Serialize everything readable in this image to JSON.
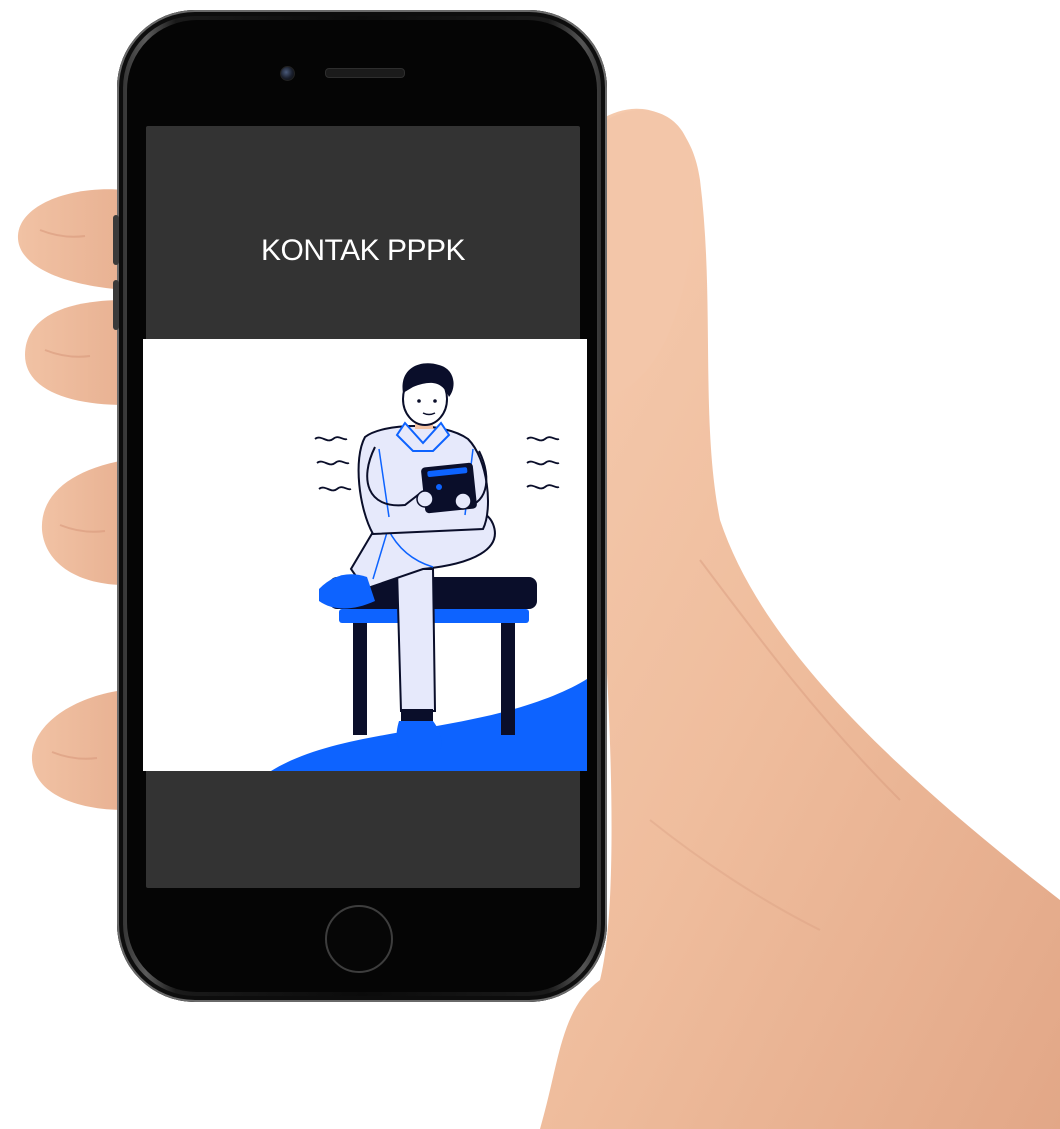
{
  "screen": {
    "title": "KONTAK PPPK"
  },
  "icons": {
    "front_camera": "camera-lens-icon",
    "earpiece": "speaker-grille-icon",
    "home": "home-button-icon"
  },
  "colors": {
    "screen_background": "#333333",
    "illustration_background": "#ffffff",
    "accent_blue": "#0d63ff",
    "light_lavender": "#e6e9fb",
    "navy": "#0a0e2a",
    "skin": "#f3c3a4"
  }
}
